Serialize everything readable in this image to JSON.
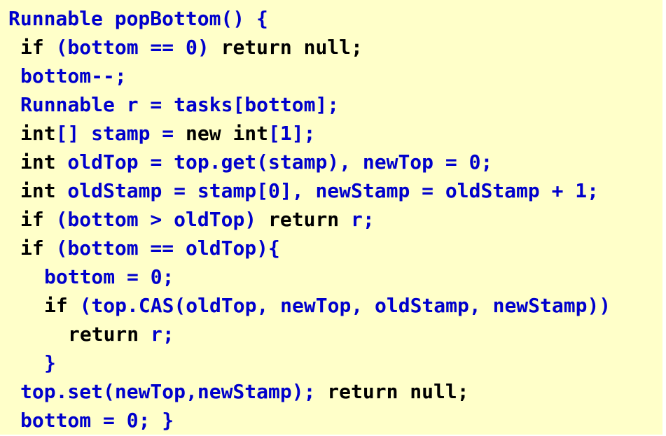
{
  "colors": {
    "background": "#ffffc9",
    "keyword": "#000000",
    "code": "#0000cc"
  },
  "code_lines": [
    {
      "indent": 0,
      "tokens": [
        {
          "text": "Runnable popBottom() {",
          "style": "code"
        }
      ]
    },
    {
      "indent": 1,
      "tokens": [
        {
          "text": "if",
          "style": "keyword"
        },
        {
          "text": " (bottom == 0) ",
          "style": "code"
        },
        {
          "text": "return null;",
          "style": "keyword"
        }
      ]
    },
    {
      "indent": 1,
      "tokens": [
        {
          "text": "bottom--;",
          "style": "code"
        }
      ]
    },
    {
      "indent": 1,
      "tokens": [
        {
          "text": "Runnable r = tasks[bottom];",
          "style": "code"
        }
      ]
    },
    {
      "indent": 1,
      "tokens": [
        {
          "text": "int",
          "style": "keyword"
        },
        {
          "text": "[] stamp = ",
          "style": "code"
        },
        {
          "text": "new int",
          "style": "keyword"
        },
        {
          "text": "[1];",
          "style": "code"
        }
      ]
    },
    {
      "indent": 1,
      "tokens": [
        {
          "text": "int",
          "style": "keyword"
        },
        {
          "text": " oldTop = top.get(stamp), newTop = 0;",
          "style": "code"
        }
      ]
    },
    {
      "indent": 1,
      "tokens": [
        {
          "text": "int",
          "style": "keyword"
        },
        {
          "text": " oldStamp = stamp[0], newStamp = oldStamp + 1;",
          "style": "code"
        }
      ]
    },
    {
      "indent": 1,
      "tokens": [
        {
          "text": "if",
          "style": "keyword"
        },
        {
          "text": " (bottom > oldTop) ",
          "style": "code"
        },
        {
          "text": "return",
          "style": "keyword"
        },
        {
          "text": " r;",
          "style": "code"
        }
      ]
    },
    {
      "indent": 1,
      "tokens": [
        {
          "text": "if",
          "style": "keyword"
        },
        {
          "text": " (bottom == oldTop){",
          "style": "code"
        }
      ]
    },
    {
      "indent": 3,
      "tokens": [
        {
          "text": "bottom = 0;",
          "style": "code"
        }
      ]
    },
    {
      "indent": 3,
      "tokens": [
        {
          "text": "if",
          "style": "keyword"
        },
        {
          "text": " (top.CAS(oldTop, newTop, oldStamp, newStamp))",
          "style": "code"
        }
      ]
    },
    {
      "indent": 5,
      "tokens": [
        {
          "text": "return",
          "style": "keyword"
        },
        {
          "text": " r;",
          "style": "code"
        }
      ]
    },
    {
      "indent": 3,
      "tokens": [
        {
          "text": "}",
          "style": "code"
        }
      ]
    },
    {
      "indent": 1,
      "tokens": [
        {
          "text": "top.set(newTop,newStamp); ",
          "style": "code"
        },
        {
          "text": "return null;",
          "style": "keyword"
        }
      ]
    },
    {
      "indent": 1,
      "tokens": [
        {
          "text": "bottom = 0; }",
          "style": "code"
        }
      ]
    }
  ]
}
